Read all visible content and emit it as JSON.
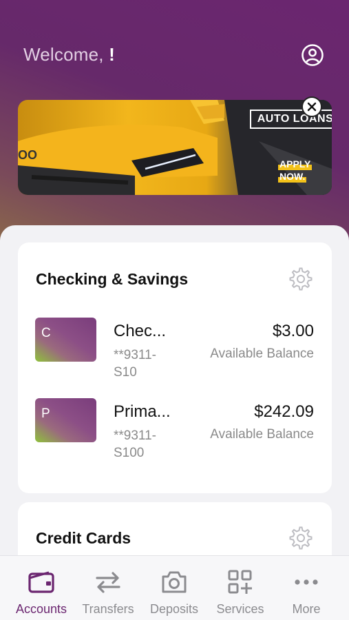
{
  "header": {
    "welcome_text": "Welcome,",
    "welcome_name": "!",
    "profile_icon": "user-circle-icon"
  },
  "banner": {
    "title": "AUTO LOANS",
    "cta_line1": "APPLY",
    "cta_line2": "NOW.",
    "car_badge_text": "OO"
  },
  "checking": {
    "title": "Checking & Savings",
    "accounts": [
      {
        "initial": "C",
        "name": "Chec...",
        "number": "**9311-S10",
        "balance": "$3.00",
        "balance_label": "Available Balance"
      },
      {
        "initial": "P",
        "name": "Prima...",
        "number": "**9311-S100",
        "balance": "$242.09",
        "balance_label": "Available Balance"
      }
    ]
  },
  "credit": {
    "title": "Credit Cards"
  },
  "tabs": [
    {
      "label": "Accounts",
      "icon": "wallet-icon",
      "active": true
    },
    {
      "label": "Transfers",
      "icon": "transfer-arrows-icon",
      "active": false
    },
    {
      "label": "Deposits",
      "icon": "camera-icon",
      "active": false
    },
    {
      "label": "Services",
      "icon": "grid-plus-icon",
      "active": false
    },
    {
      "label": "More",
      "icon": "more-dots-icon",
      "active": false
    }
  ],
  "colors": {
    "brand_purple": "#6b2670",
    "accent_yellow": "#f3c21a",
    "inactive_gray": "#8b8b8f"
  }
}
